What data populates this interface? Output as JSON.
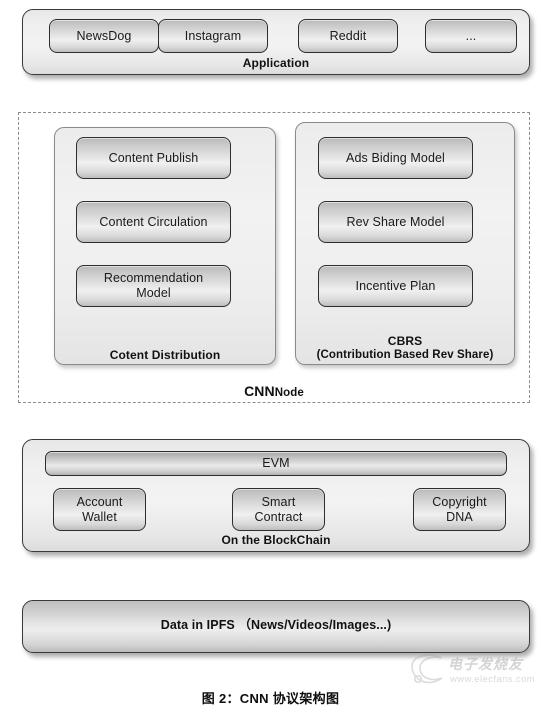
{
  "figure": {
    "caption": "图 2：CNN 协议架构图"
  },
  "watermark": {
    "chinese": "电子发烧友",
    "url": "www.elecfans.com"
  },
  "application_layer": {
    "label": "Application",
    "apps": [
      {
        "name": "NewsDog"
      },
      {
        "name": "Instagram"
      },
      {
        "name": "Reddit"
      },
      {
        "name": "..."
      }
    ]
  },
  "cnn_node": {
    "label_strong": "CNN",
    "label_rest": "Node",
    "columns": [
      {
        "label": "Cotent Distribution",
        "items": [
          {
            "name": "Content Publish"
          },
          {
            "name": "Content Circulation"
          },
          {
            "name": "Recommendation\nModel"
          }
        ]
      },
      {
        "label_line1": "CBRS",
        "label_line2": "(Contribution Based Rev Share)",
        "items": [
          {
            "name": "Ads Biding Model"
          },
          {
            "name": "Rev Share Model"
          },
          {
            "name": "Incentive Plan"
          }
        ]
      }
    ]
  },
  "blockchain_layer": {
    "label": "On the BlockChain",
    "evm": "EVM",
    "items": [
      {
        "name": "Account\nWallet"
      },
      {
        "name": "Smart\nContract"
      },
      {
        "name": "Copyright\nDNA"
      }
    ]
  },
  "storage_layer": {
    "label": "Data in IPFS （News/Videos/Images...)"
  },
  "colors": {
    "panel_border": "#3a3a3a",
    "chip_border": "#2e2e2e",
    "dashed_border": "#8d8d8d",
    "text": "#1a1a1a",
    "background": "#ffffff"
  }
}
